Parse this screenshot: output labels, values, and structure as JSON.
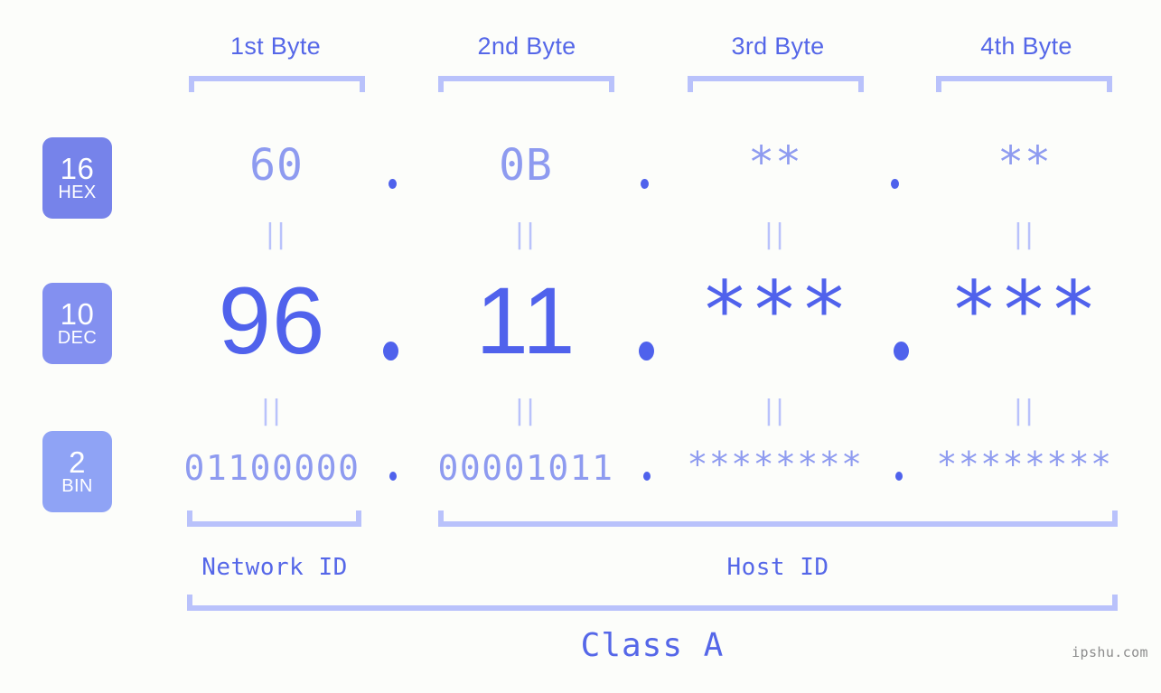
{
  "background_color": "#fcfdfa",
  "accent_strong": "#5062ec",
  "accent_light": "#8e9bf0",
  "bracket_color": "#b9c2fb",
  "header": {
    "bytes": [
      {
        "label": "1st Byte"
      },
      {
        "label": "2nd Byte"
      },
      {
        "label": "3rd Byte"
      },
      {
        "label": "4th Byte"
      }
    ]
  },
  "rows": {
    "hex": {
      "badge_base": "16",
      "badge_name": "HEX",
      "badge_color": "#7683ea",
      "values": [
        "60",
        "0B",
        "**",
        "**"
      ],
      "separator": "."
    },
    "dec": {
      "badge_base": "10",
      "badge_name": "DEC",
      "badge_color": "#8390f0",
      "values": [
        "96",
        "11",
        "***",
        "***"
      ],
      "separator": "."
    },
    "bin": {
      "badge_base": "2",
      "badge_name": "BIN",
      "badge_color": "#8fa3f5",
      "values": [
        "01100000",
        "00001011",
        "********",
        "********"
      ],
      "separator": "."
    }
  },
  "connector": {
    "glyph": "||"
  },
  "footer": {
    "network_id_label": "Network ID",
    "host_id_label": "Host ID",
    "class_label": "Class A",
    "watermark": "ipshu.com"
  }
}
